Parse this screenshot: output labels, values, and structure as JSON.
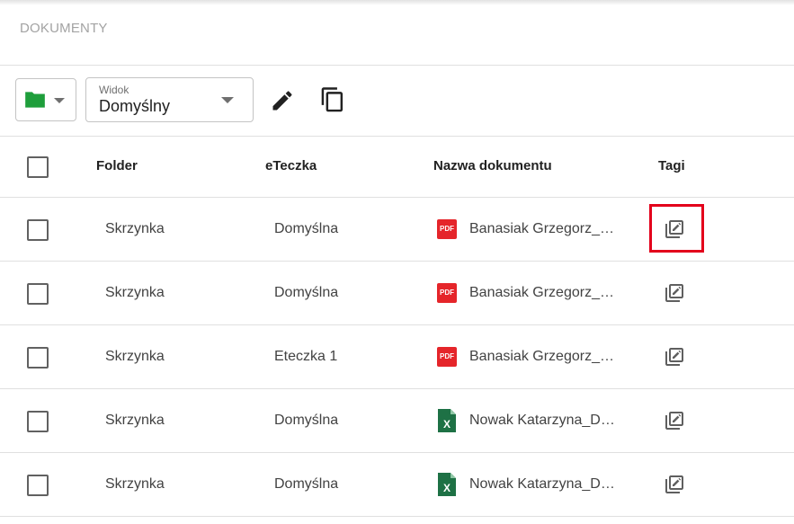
{
  "page": {
    "title": "DOKUMENTY"
  },
  "toolbar": {
    "folder_icon": "folder-icon",
    "view": {
      "label": "Widok",
      "value": "Domyślny"
    },
    "edit_icon": "pencil-icon",
    "copy_icon": "copy-icon"
  },
  "table": {
    "columns": [
      "Folder",
      "eTeczka",
      "Nazwa dokumentu",
      "Tagi"
    ],
    "rows": [
      {
        "folder": "Skrzynka",
        "eteczka": "Domyślna",
        "type": "pdf",
        "type_label": "PDF",
        "name": "Banasiak Grzegorz_Default_Dokument.pdf",
        "name_display": "Banasiak Grzegorz_D…",
        "tag_icon": "edit-tags-icon",
        "highlighted": true
      },
      {
        "folder": "Skrzynka",
        "eteczka": "Domyślna",
        "type": "pdf",
        "type_label": "PDF",
        "name": "Banasiak Grzegorz_Default_Dokument.pdf",
        "name_display": "Banasiak Grzegorz_D…",
        "tag_icon": "edit-tags-icon",
        "highlighted": false
      },
      {
        "folder": "Skrzynka",
        "eteczka": "Eteczka 1",
        "type": "pdf",
        "type_label": "PDF",
        "name": "Banasiak Grzegorz_Default_Dokument.pdf",
        "name_display": "Banasiak Grzegorz_D…",
        "tag_icon": "edit-tags-icon",
        "highlighted": false
      },
      {
        "folder": "Skrzynka",
        "eteczka": "Domyślna",
        "type": "xls",
        "type_label": "X",
        "name": "Nowak Katarzyna_Default_Dokument.xlsx",
        "name_display": "Nowak Katarzyna_Def…",
        "tag_icon": "edit-tags-icon",
        "highlighted": false
      },
      {
        "folder": "Skrzynka",
        "eteczka": "Domyślna",
        "type": "xls",
        "type_label": "X",
        "name": "Nowak Katarzyna_Default_Dokument.xlsx",
        "name_display": "Nowak Katarzyna_Def…",
        "tag_icon": "edit-tags-icon",
        "highlighted": false
      }
    ]
  },
  "colors": {
    "folder": "#1e9e3b",
    "pdf": "#e5252a",
    "xls": "#1e7145",
    "highlight": "#e3001b",
    "icon": "#5f5f5f"
  }
}
